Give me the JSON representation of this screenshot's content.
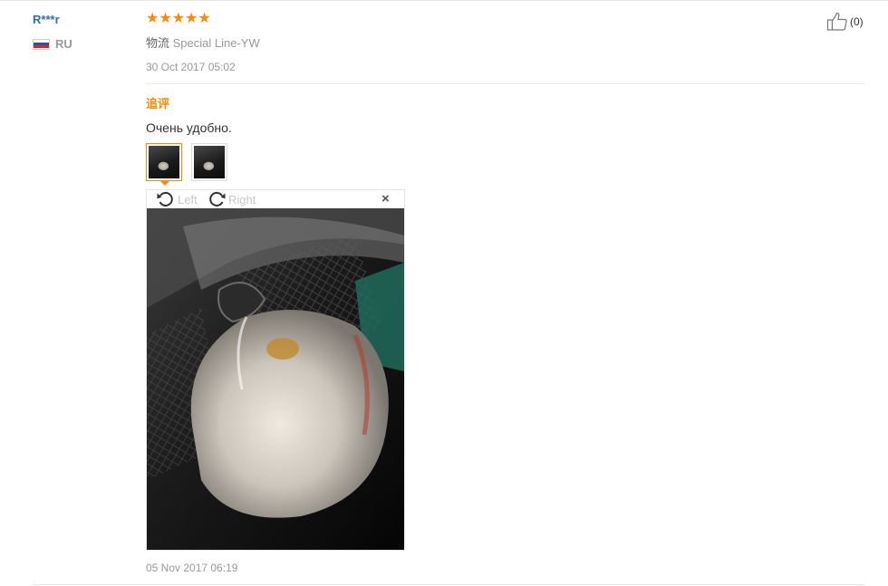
{
  "reviewer": {
    "name": "R***r",
    "country_code": "RU",
    "flag_colors": [
      "#ffffff",
      "#2b50a8",
      "#d6262a"
    ]
  },
  "rating": {
    "value": 5,
    "max": 5,
    "stars": "★★★★★",
    "color": "#ff8a00"
  },
  "logistics": {
    "label": "物流",
    "value": "Special Line-YW"
  },
  "review_date": "30 Oct 2017 05:02",
  "helpful": {
    "icon": "thumbs-up-icon",
    "count": "(0)"
  },
  "followup": {
    "title": "追评",
    "text": "Очень удобно.",
    "images": [
      {
        "name": "photo-1",
        "selected": true
      },
      {
        "name": "photo-2",
        "selected": false
      }
    ],
    "viewer": {
      "rotate_left_label": "Left",
      "rotate_right_label": "Right",
      "close_label": "×"
    },
    "date": "05 Nov 2017 06:19"
  },
  "colors": {
    "accent": "#ff8a00",
    "link": "#2a6ebb",
    "muted": "#999999"
  }
}
